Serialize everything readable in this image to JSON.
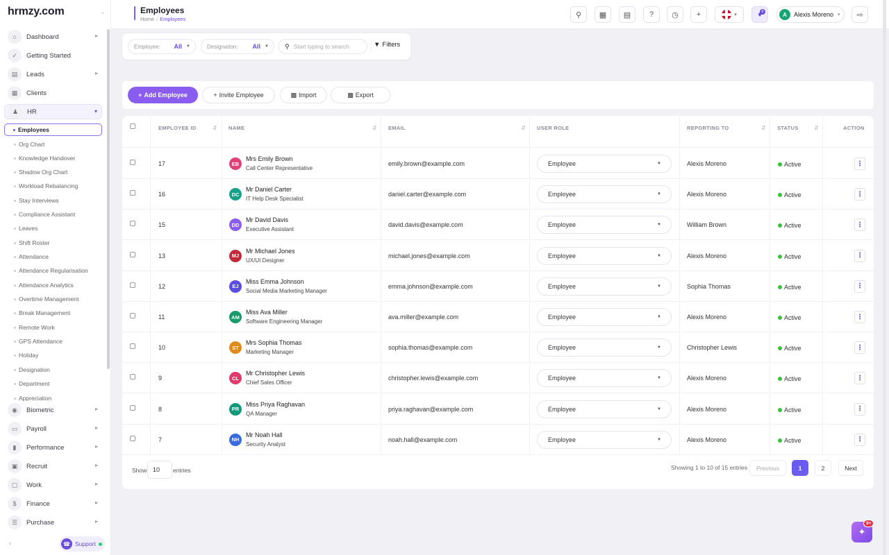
{
  "app": {
    "logo": "hrmzy.com"
  },
  "header": {
    "title": "Employees",
    "breadcrumb": [
      "Home",
      "Employees"
    ],
    "notif_count": "8",
    "user_initial": "A",
    "user_name": "Alexis Moreno"
  },
  "sidebar": {
    "items": [
      {
        "label": "Dashboard",
        "icon": "home-icon"
      },
      {
        "label": "Getting Started",
        "icon": "check-icon"
      },
      {
        "label": "Leads",
        "icon": "contact-card-icon"
      },
      {
        "label": "Clients",
        "icon": "building-icon"
      },
      {
        "label": "HR",
        "icon": "users-icon"
      }
    ],
    "hr_subitems": [
      "Employees",
      "Org Chart",
      "Knowledge Handover",
      "Shadow Org Chart",
      "Workload Rebalancing",
      "Stay Interviews",
      "Compliance Assistant",
      "Leaves",
      "Shift Roster",
      "Attendance",
      "Attendance Regularisation",
      "Attendance Analytics",
      "Overtime Management",
      "Break Management",
      "Remote Work",
      "GPS Attendance",
      "Holiday",
      "Designation",
      "Department",
      "Appreciation"
    ],
    "bottom_items": [
      {
        "label": "Biometric",
        "icon": "fingerprint-icon"
      },
      {
        "label": "Payroll",
        "icon": "wallet-icon"
      },
      {
        "label": "Performance",
        "icon": "bar-chart-icon"
      },
      {
        "label": "Recruit",
        "icon": "id-badge-icon"
      },
      {
        "label": "Work",
        "icon": "briefcase-icon"
      },
      {
        "label": "Finance",
        "icon": "dollar-icon"
      },
      {
        "label": "Purchase",
        "icon": "layers-icon"
      }
    ],
    "support_label": "Support"
  },
  "filters": {
    "employee_label": "Employee:",
    "employee_value": "All",
    "designation_label": "Designation:",
    "designation_value": "All",
    "search_placeholder": "Start typing to search",
    "filters_label": "Filters"
  },
  "actions": {
    "add": "Add Employee",
    "invite": "Invite Employee",
    "import": "Import",
    "export": "Export"
  },
  "table": {
    "columns": [
      "EMPLOYEE ID",
      "NAME",
      "EMAIL",
      "USER ROLE",
      "REPORTING TO",
      "STATUS",
      "ACTION"
    ],
    "rows": [
      {
        "id": "17",
        "initials": "EB",
        "color": "#e0407a",
        "name": "Mrs Emily Brown",
        "designation": "Call Center Representative",
        "email": "emily.brown@example.com",
        "role": "Employee",
        "reporting_to": "Alexis Moreno",
        "status": "Active"
      },
      {
        "id": "16",
        "initials": "DC",
        "color": "#17a08a",
        "name": "Mr Daniel Carter",
        "designation": "IT Help Desk Specialist",
        "email": "daniel.carter@example.com",
        "role": "Employee",
        "reporting_to": "Alexis Moreno",
        "status": "Active"
      },
      {
        "id": "15",
        "initials": "DD",
        "color": "#8a5cf0",
        "name": "Mr David Davis",
        "designation": "Executive Assistant",
        "email": "david.davis@example.com",
        "role": "Employee",
        "reporting_to": "William Brown",
        "status": "Active"
      },
      {
        "id": "13",
        "initials": "MJ",
        "color": "#c42a3c",
        "name": "Mr Michael Jones",
        "designation": "UX/UI Designer",
        "email": "michael.jones@example.com",
        "role": "Employee",
        "reporting_to": "Alexis Moreno",
        "status": "Active"
      },
      {
        "id": "12",
        "initials": "EJ",
        "color": "#5b4ce0",
        "name": "Miss Emma Johnson",
        "designation": "Social Media Marketing Manager",
        "email": "emma.johnson@example.com",
        "role": "Employee",
        "reporting_to": "Sophia Thomas",
        "status": "Active"
      },
      {
        "id": "11",
        "initials": "AM",
        "color": "#1a9a6a",
        "name": "Miss Ava Miller",
        "designation": "Software Engineering Manager",
        "email": "ava.miller@example.com",
        "role": "Employee",
        "reporting_to": "Alexis Moreno",
        "status": "Active"
      },
      {
        "id": "10",
        "initials": "ST",
        "color": "#e08a1a",
        "name": "Mrs Sophia Thomas",
        "designation": "Marketing Manager",
        "email": "sophia.thomas@example.com",
        "role": "Employee",
        "reporting_to": "Christopher Lewis",
        "status": "Active"
      },
      {
        "id": "9",
        "initials": "CL",
        "color": "#e03a6a",
        "name": "Mr Christopher Lewis",
        "designation": "Chief Sales Officer",
        "email": "christopher.lewis@example.com",
        "role": "Employee",
        "reporting_to": "Alexis Moreno",
        "status": "Active"
      },
      {
        "id": "8",
        "initials": "PR",
        "color": "#149a7a",
        "name": "Miss Priya Raghavan",
        "designation": "QA Manager",
        "email": "priya.raghavan@example.com",
        "role": "Employee",
        "reporting_to": "Alexis Moreno",
        "status": "Active"
      },
      {
        "id": "7",
        "initials": "NH",
        "color": "#3a6ae0",
        "name": "Mr Noah Hall",
        "designation": "Security Analyst",
        "email": "noah.hall@example.com",
        "role": "Employee",
        "reporting_to": "Alexis Moreno",
        "status": "Active"
      }
    ]
  },
  "pagination": {
    "show_label": "Show",
    "page_size": "10",
    "entries_label": "entries",
    "summary": "Showing 1 to 10 of 15 entries",
    "previous": "Previous",
    "pages": [
      "1",
      "2"
    ],
    "next": "Next"
  },
  "fab_badge": "9+"
}
